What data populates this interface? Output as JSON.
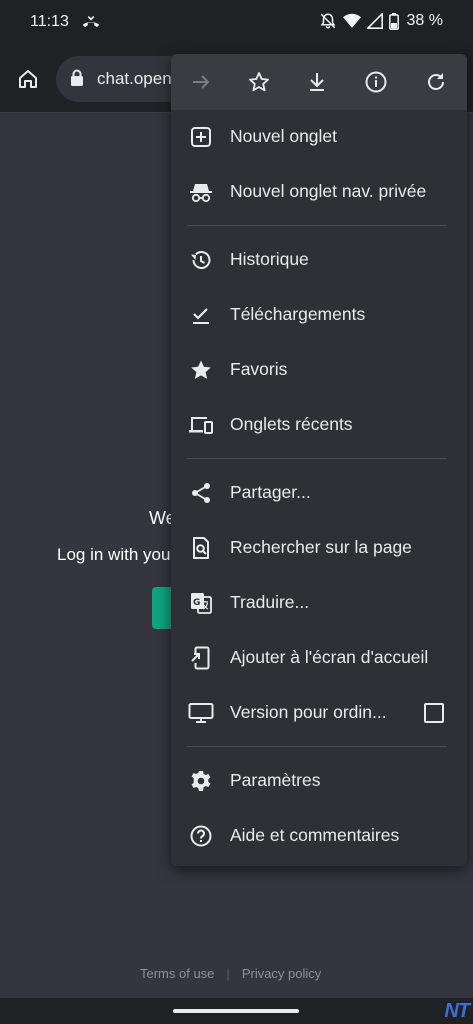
{
  "status_bar": {
    "time": "11:13",
    "battery": "38 %",
    "icons": [
      "missed-call-icon",
      "bell-off-icon",
      "wifi-icon",
      "signal-icon",
      "battery-icon"
    ]
  },
  "toolbar": {
    "url": "chat.open",
    "icons": [
      "home-icon",
      "lock-icon"
    ]
  },
  "menu": {
    "top_actions": [
      "forward-icon",
      "star-icon",
      "download-icon",
      "info-icon",
      "refresh-icon"
    ],
    "items": [
      {
        "label": "Nouvel onglet",
        "icon": "new-tab-icon"
      },
      {
        "label": "Nouvel onglet nav. privée",
        "icon": "incognito-icon"
      },
      {
        "label": "Historique",
        "icon": "history-icon"
      },
      {
        "label": "Téléchargements",
        "icon": "downloads-icon"
      },
      {
        "label": "Favoris",
        "icon": "star-icon"
      },
      {
        "label": "Onglets récents",
        "icon": "devices-icon"
      },
      {
        "label": "Partager...",
        "icon": "share-icon"
      },
      {
        "label": "Rechercher sur la page",
        "icon": "find-in-page-icon"
      },
      {
        "label": "Traduire...",
        "icon": "translate-icon"
      },
      {
        "label": "Ajouter à l'écran d'accueil",
        "icon": "add-to-home-icon"
      },
      {
        "label": "Version pour ordin...",
        "icon": "desktop-icon",
        "checked": false
      },
      {
        "label": "Paramètres",
        "icon": "settings-icon"
      },
      {
        "label": "Aide et commentaires",
        "icon": "help-icon"
      }
    ]
  },
  "page": {
    "welcome_partial": "We",
    "login_partial": "Log in with you",
    "footer": {
      "terms": "Terms of use",
      "privacy": "Privacy policy"
    }
  },
  "watermark": "NT",
  "colors": {
    "menu_bg": "#2f3035",
    "page_bg": "#34353f",
    "accent_green": "#10a37f"
  }
}
